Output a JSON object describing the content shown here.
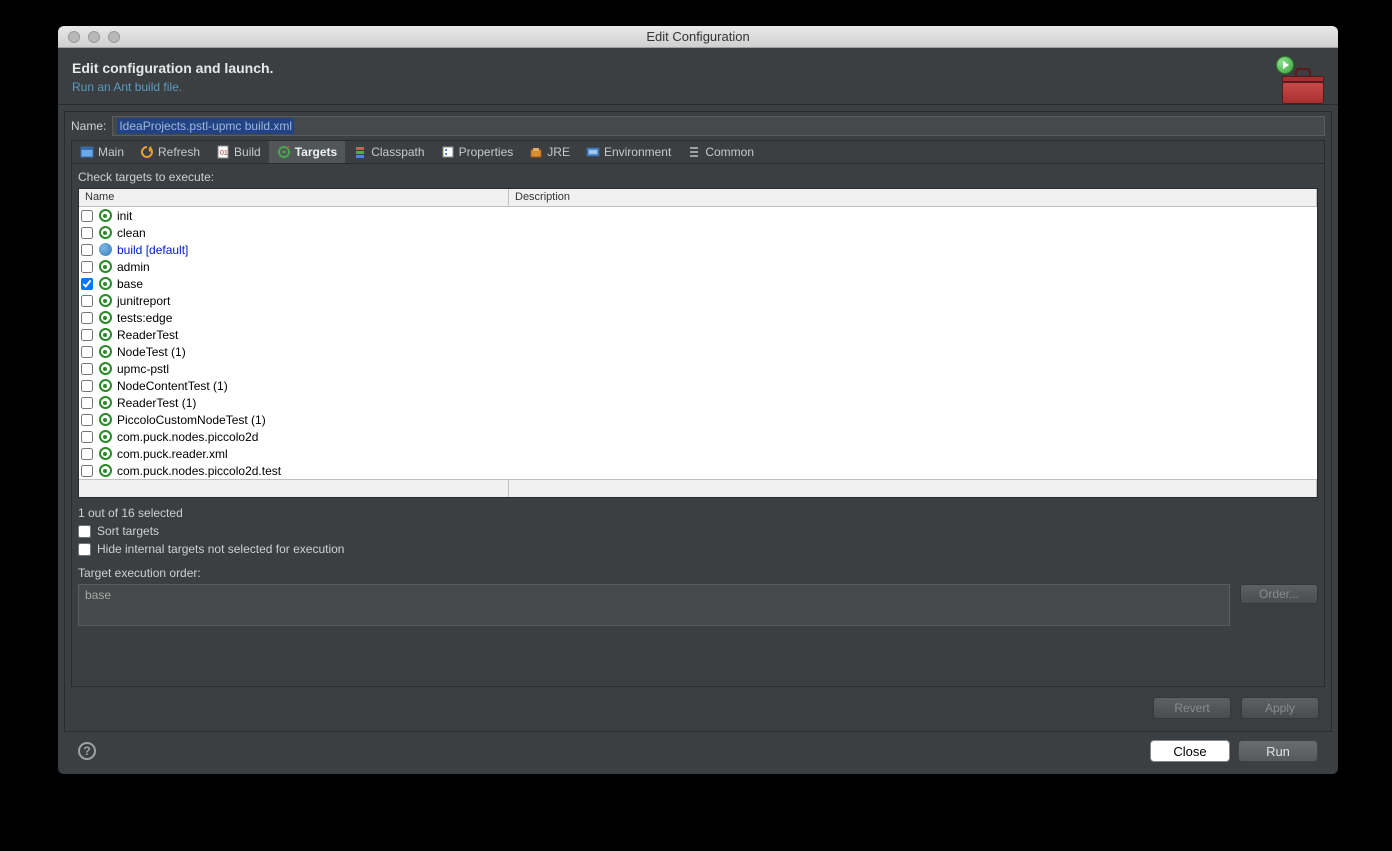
{
  "titlebar": {
    "title": "Edit Configuration"
  },
  "header": {
    "title": "Edit configuration and launch.",
    "subtitle": "Run an Ant build file."
  },
  "name": {
    "label": "Name:",
    "value": "IdeaProjects.pstl-upmc build.xml"
  },
  "tabs": [
    {
      "label": "Main"
    },
    {
      "label": "Refresh"
    },
    {
      "label": "Build"
    },
    {
      "label": "Targets"
    },
    {
      "label": "Classpath"
    },
    {
      "label": "Properties"
    },
    {
      "label": "JRE"
    },
    {
      "label": "Environment"
    },
    {
      "label": "Common"
    }
  ],
  "activeTab": 3,
  "targets": {
    "checkLabel": "Check targets to execute:",
    "columns": {
      "name": "Name",
      "desc": "Description"
    },
    "rows": [
      {
        "name": "init",
        "checked": false,
        "default": false
      },
      {
        "name": "clean",
        "checked": false,
        "default": false
      },
      {
        "name": "build [default]",
        "checked": false,
        "default": true
      },
      {
        "name": "admin",
        "checked": false,
        "default": false
      },
      {
        "name": "base",
        "checked": true,
        "default": false
      },
      {
        "name": "junitreport",
        "checked": false,
        "default": false
      },
      {
        "name": "tests:edge",
        "checked": false,
        "default": false
      },
      {
        "name": "ReaderTest",
        "checked": false,
        "default": false
      },
      {
        "name": "NodeTest (1)",
        "checked": false,
        "default": false
      },
      {
        "name": "upmc-pstl",
        "checked": false,
        "default": false
      },
      {
        "name": "NodeContentTest (1)",
        "checked": false,
        "default": false
      },
      {
        "name": "ReaderTest (1)",
        "checked": false,
        "default": false
      },
      {
        "name": "PiccoloCustomNodeTest (1)",
        "checked": false,
        "default": false
      },
      {
        "name": "com.puck.nodes.piccolo2d",
        "checked": false,
        "default": false
      },
      {
        "name": "com.puck.reader.xml",
        "checked": false,
        "default": false
      },
      {
        "name": "com.puck.nodes.piccolo2d.test",
        "checked": false,
        "default": false
      }
    ],
    "status": "1 out of 16 selected",
    "sortLabel": "Sort targets",
    "hideLabel": "Hide internal targets not selected for execution",
    "orderLabel": "Target execution order:",
    "orderValue": "base",
    "orderBtn": "Order..."
  },
  "buttons": {
    "revert": "Revert",
    "apply": "Apply",
    "close": "Close",
    "run": "Run"
  }
}
